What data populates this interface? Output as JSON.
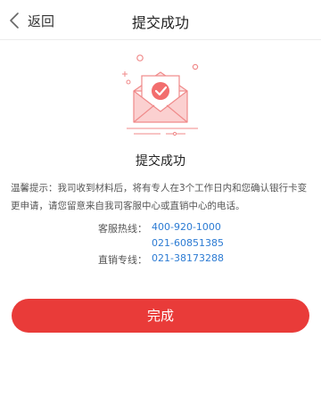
{
  "header": {
    "back_label": "返回",
    "title": "提交成功"
  },
  "status": {
    "title": "提交成功"
  },
  "notice": {
    "text": "温馨提示：我司收到材料后，将有专人在3个工作日内和您确认银行卡变更申请，请您留意来自我司客服中心或直销中心的电话。"
  },
  "hotlines": {
    "rows": [
      {
        "label": "客服热线：",
        "value": "400-920-1000"
      },
      {
        "label": "",
        "value": "021-60851385"
      },
      {
        "label": "直销专线：",
        "value": "021-38173288"
      }
    ]
  },
  "actions": {
    "done_label": "完成"
  },
  "colors": {
    "accent": "#e93b39",
    "link": "#2c7bd3",
    "illustration_stroke": "#f08a8a",
    "illustration_fill": "#fde3e3"
  },
  "icons": {
    "back": "chevron-left-icon",
    "illustration": "envelope-check-icon"
  }
}
